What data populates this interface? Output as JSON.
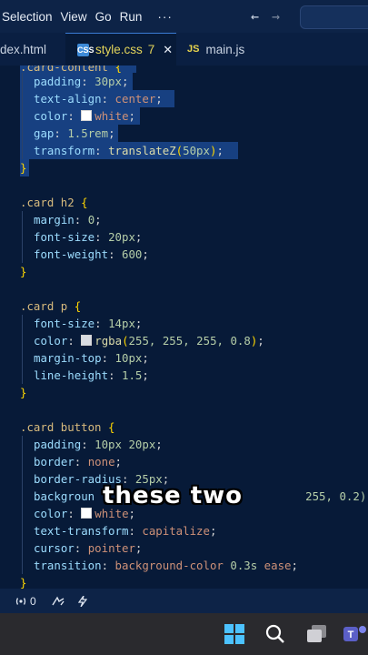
{
  "menubar": {
    "items": [
      "Selection",
      "View",
      "Go",
      "Run"
    ],
    "more": "···"
  },
  "tabs": [
    {
      "label": "dex.html"
    },
    {
      "label": "style.css",
      "badge": "7",
      "icon": "CSS"
    },
    {
      "label": "main.js",
      "icon": "JS"
    }
  ],
  "code": {
    "line1": {
      "prop": "padding",
      "num": "30px"
    },
    "line2": {
      "prop": "text-align",
      "val": "center"
    },
    "line3": {
      "prop": "color",
      "val": "white"
    },
    "line4": {
      "prop": "gap",
      "num": "1.5rem"
    },
    "line5": {
      "prop": "transform",
      "fn": "translateZ",
      "num": "50px"
    },
    "close1": "}",
    "sel2": ".card h2",
    "line7": {
      "prop": "margin",
      "num": "0"
    },
    "line8": {
      "prop": "font-size",
      "num": "20px"
    },
    "line9": {
      "prop": "font-weight",
      "num": "600"
    },
    "close2": "}",
    "sel3": ".card p",
    "line11": {
      "prop": "font-size",
      "num": "14px"
    },
    "line12": {
      "prop": "color",
      "fn": "rgba",
      "args": "255, 255, 255, 0.8"
    },
    "line13": {
      "prop": "margin-top",
      "num": "10px"
    },
    "line14": {
      "prop": "line-height",
      "num": "1.5"
    },
    "close3": "}",
    "sel4": ".card button",
    "line16": {
      "prop": "padding",
      "num": "10px 20px"
    },
    "line17": {
      "prop": "border",
      "val": "none"
    },
    "line18": {
      "prop": "border-radius",
      "num": "25px"
    },
    "line19": {
      "prop": "backgroun",
      "tail": "255, 0.2);"
    },
    "line20": {
      "prop": "color",
      "val": "white"
    },
    "line21": {
      "prop": "text-transform",
      "val": "capitalize"
    },
    "line22": {
      "prop": "cursor",
      "val": "pointer"
    },
    "line23": {
      "prop": "transition",
      "val": "background-color",
      "num": "0.3s",
      "val2": "ease"
    },
    "close4": "}"
  },
  "caption": "these two",
  "statusbar": {
    "ports": "0"
  },
  "colors": {
    "editor_bg": "#071a38",
    "selection": "#1e4d99",
    "property": "#9cdcfe",
    "selector": "#d7ba7d",
    "number": "#b5cea8"
  }
}
